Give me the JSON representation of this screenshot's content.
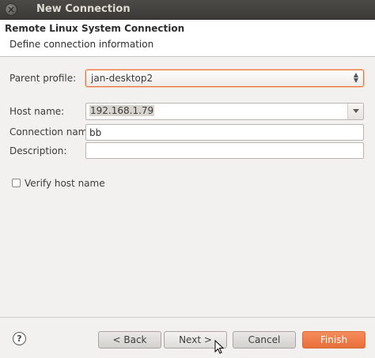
{
  "window": {
    "title": "New Connection",
    "close_glyph": "×"
  },
  "header": {
    "title": "Remote Linux System Connection",
    "description": "Define connection information"
  },
  "form": {
    "parent_profile": {
      "label": "Parent profile:",
      "value": "jan-desktop2"
    },
    "host_name": {
      "label": "Host name:",
      "value": "192.168.1.79"
    },
    "connection_name": {
      "label": "Connection name:",
      "value": "bb"
    },
    "description": {
      "label": "Description:",
      "value": ""
    },
    "verify_host": {
      "label": "Verify host name",
      "checked": false
    }
  },
  "buttons": {
    "back": "< Back",
    "next": "Next >",
    "cancel": "Cancel",
    "finish": "Finish"
  },
  "help_glyph": "?",
  "colors": {
    "accent": "#e9733f",
    "primary_button": "#f07d48",
    "titlebar": "#3c3b37"
  }
}
